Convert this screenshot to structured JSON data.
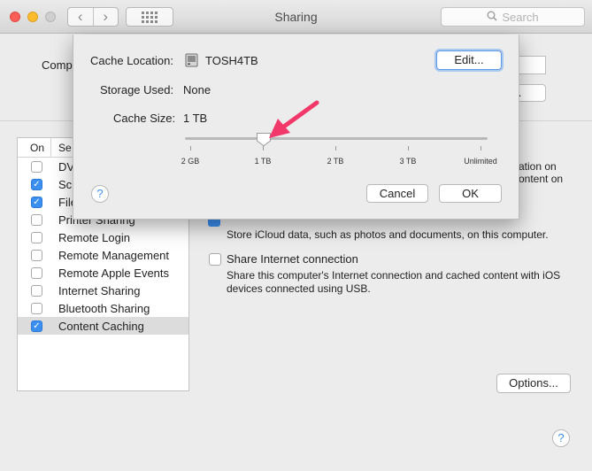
{
  "window": {
    "title": "Sharing",
    "search_placeholder": "Search"
  },
  "background": {
    "computer_name_label": "Comp",
    "edit_button_partial": "it...",
    "services_header": {
      "on": "On",
      "service": "Se"
    },
    "services": [
      {
        "label": "DV",
        "checked": false
      },
      {
        "label": "Sc",
        "checked": true
      },
      {
        "label": "File",
        "checked": true
      },
      {
        "label": "Printer Sharing",
        "checked": false
      },
      {
        "label": "Remote Login",
        "checked": false
      },
      {
        "label": "Remote Management",
        "checked": false
      },
      {
        "label": "Remote Apple Events",
        "checked": false
      },
      {
        "label": "Internet Sharing",
        "checked": false
      },
      {
        "label": "Bluetooth Sharing",
        "checked": false
      },
      {
        "label": "Content Caching",
        "checked": true
      }
    ],
    "clipped_text_1": "ation on",
    "clipped_text_2": "ontent on",
    "icloud_description": "Store iCloud data, such as photos and documents, on this computer.",
    "share_internet_label": "Share Internet connection",
    "share_internet_description": "Share this computer's Internet connection and cached content with iOS devices connected using USB.",
    "options_button": "Options...",
    "help_label": "?"
  },
  "sheet": {
    "cache_location_label": "Cache Location:",
    "cache_location_value": "TOSH4TB",
    "edit_button": "Edit...",
    "storage_used_label": "Storage Used:",
    "storage_used_value": "None",
    "cache_size_label": "Cache Size:",
    "cache_size_value": "1 TB",
    "slider": {
      "ticks": [
        "2 GB",
        "1 TB",
        "2 TB",
        "3 TB",
        "Unlimited"
      ],
      "selected_index": 1
    },
    "help_label": "?",
    "cancel_button": "Cancel",
    "ok_button": "OK"
  },
  "colors": {
    "accent": "#3b8ff0",
    "annotation_arrow": "#f2386b"
  }
}
